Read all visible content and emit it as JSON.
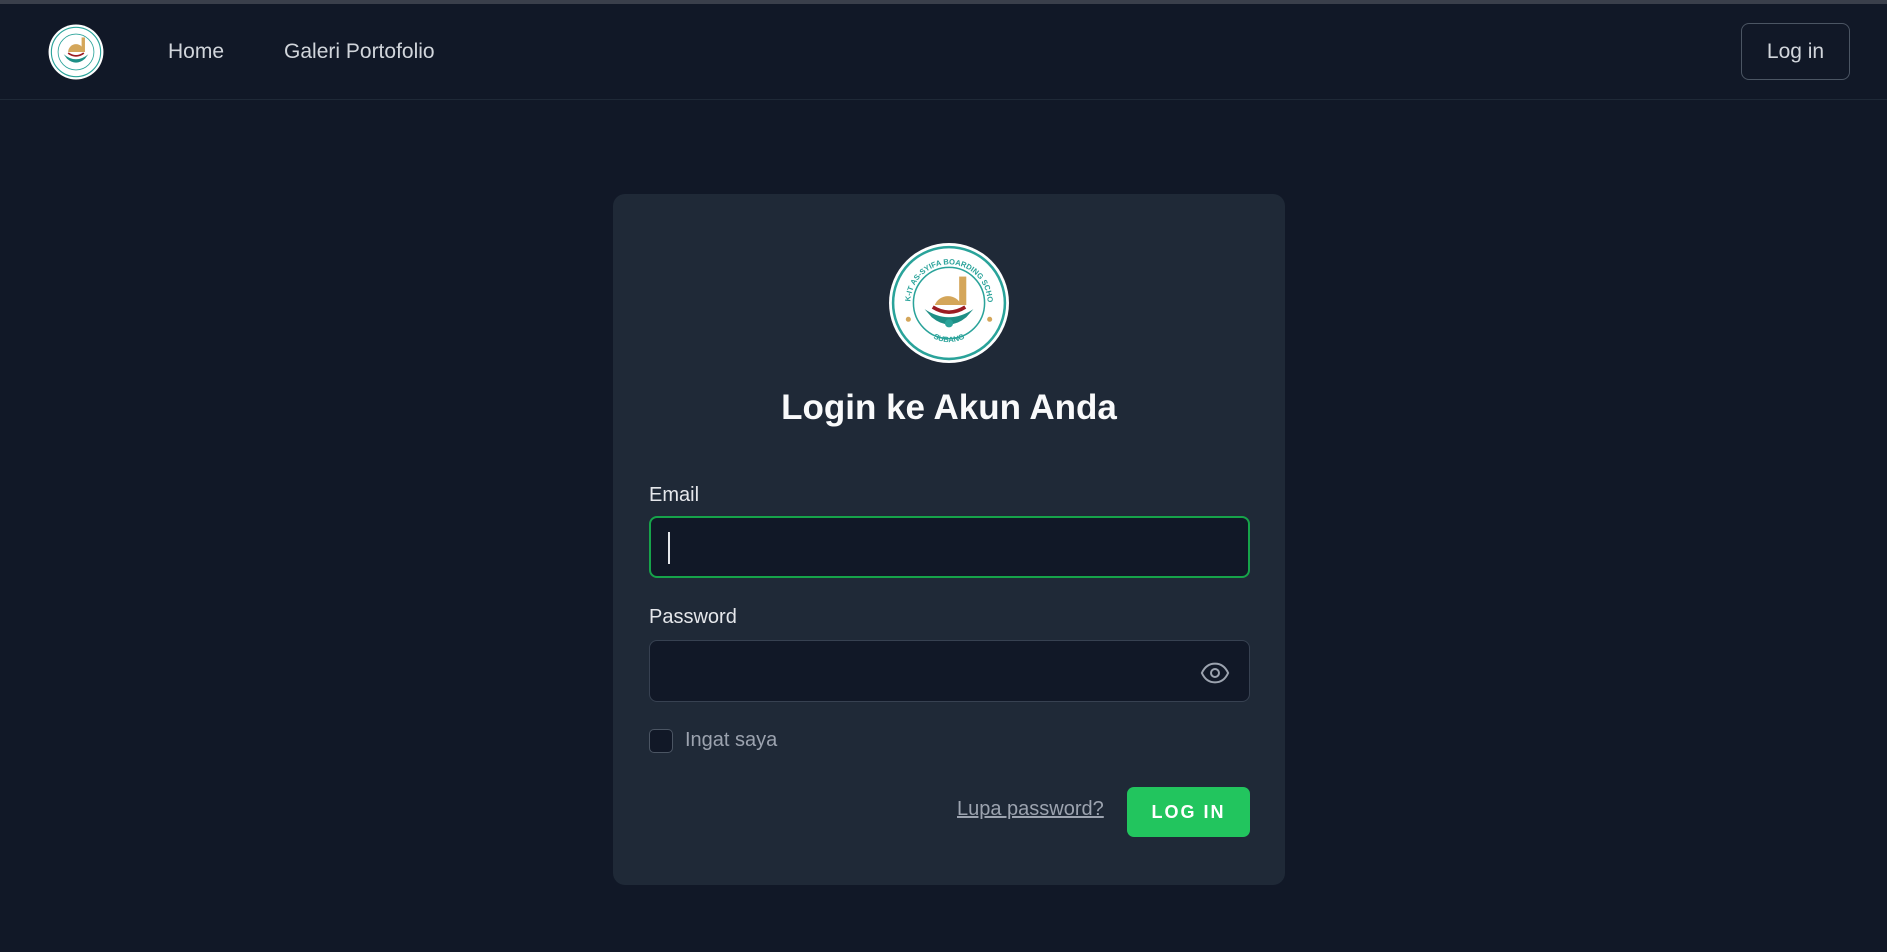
{
  "nav": {
    "links": [
      "Home",
      "Galeri Portofolio"
    ],
    "login_label": "Log in"
  },
  "logo": {
    "seal_text_top": "SMK-IT AS-SYIFA BOARDING SCHOOL",
    "seal_text_bottom": "SUBANG"
  },
  "login_card": {
    "title": "Login ke Akun Anda",
    "email_label": "Email",
    "email_value": "",
    "password_label": "Password",
    "password_value": "",
    "remember_label": "Ingat saya",
    "forgot_label": "Lupa password?",
    "submit_label": "LOG IN"
  },
  "colors": {
    "background": "#111827",
    "card": "#1f2937",
    "accent": "#22c55e",
    "focus_border": "#16a34a"
  },
  "icons": [
    "school-seal-logo",
    "eye-icon"
  ]
}
